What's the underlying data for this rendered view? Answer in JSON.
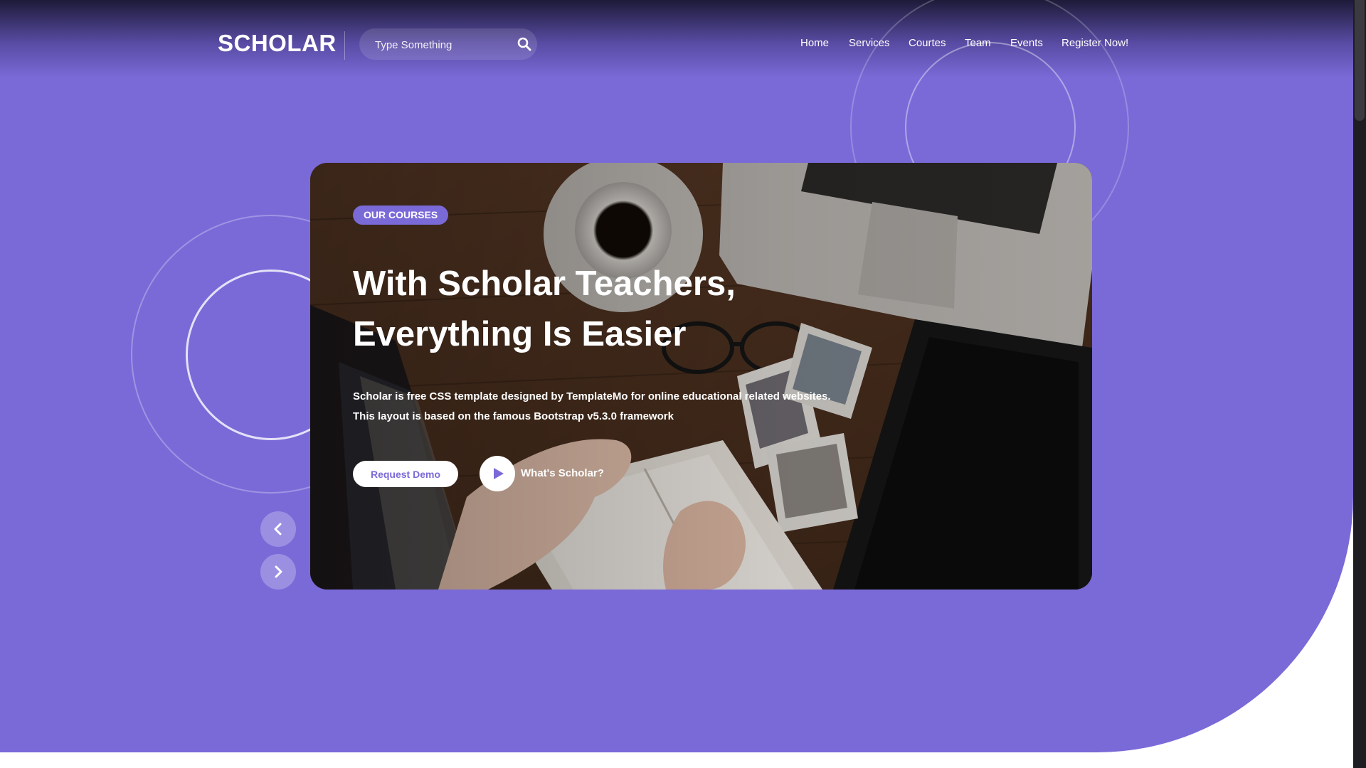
{
  "header": {
    "logo": "SCHOLAR",
    "search": {
      "placeholder": "Type Something",
      "value": ""
    },
    "nav": [
      {
        "label": "Home"
      },
      {
        "label": "Services"
      },
      {
        "label": "Courtes"
      },
      {
        "label": "Team"
      },
      {
        "label": "Events"
      },
      {
        "label": "Register Now!"
      }
    ]
  },
  "hero": {
    "tag": "OUR COURSES",
    "title_line1": "With Scholar Teachers,",
    "title_line2": "Everything Is Easier",
    "description": "Scholar is free CSS template designed by TemplateMo for online educational related websites. This layout is based on the famous Bootstrap v5.3.0 framework",
    "demo_button": "Request Demo",
    "play_label": "What's Scholar?",
    "background_image": "desk-with-laptop-coffee-notebook-photo"
  },
  "carousel": {
    "prev_icon": "chevron-left-icon",
    "next_icon": "chevron-right-icon"
  },
  "colors": {
    "primary": "#7a6ad8",
    "header_dark": "#191630",
    "white": "#ffffff"
  }
}
